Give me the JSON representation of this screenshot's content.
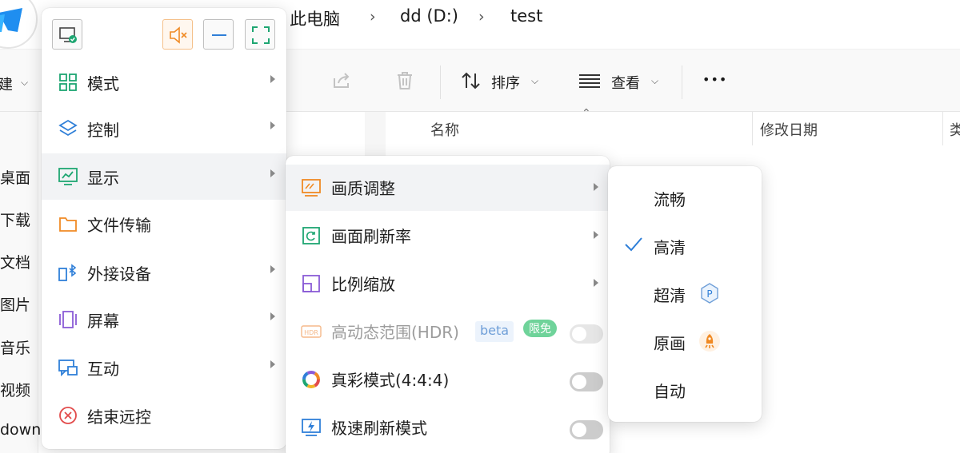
{
  "explorer": {
    "breadcrumb": [
      "此电脑",
      "dd (D:)",
      "test"
    ],
    "toolbar": {
      "sort_label": "排序",
      "view_label": "查看",
      "more_label": "•••"
    },
    "nav_items": [
      "桌面",
      "下载",
      "文档",
      "图片",
      "音乐",
      "视频",
      "down"
    ],
    "nav_top_fragment": "建",
    "columns": {
      "name": "名称",
      "modified": "修改日期",
      "type_fragment": "类"
    }
  },
  "main_menu": {
    "items": [
      {
        "label": "模式",
        "icon": "grid-icon",
        "has_submenu": true
      },
      {
        "label": "控制",
        "icon": "layers-icon",
        "has_submenu": true
      },
      {
        "label": "显示",
        "icon": "monitor-chart-icon",
        "has_submenu": true,
        "active": true
      },
      {
        "label": "文件传输",
        "icon": "folder-icon",
        "has_submenu": false
      },
      {
        "label": "外接设备",
        "icon": "bluetooth-device-icon",
        "has_submenu": true
      },
      {
        "label": "屏幕",
        "icon": "screens-icon",
        "has_submenu": true
      },
      {
        "label": "互动",
        "icon": "chat-icon",
        "has_submenu": true
      },
      {
        "label": "结束远控",
        "icon": "close-circle-icon",
        "has_submenu": false
      }
    ]
  },
  "display_menu": {
    "items": [
      {
        "label": "画质调整",
        "has_submenu": true
      },
      {
        "label": "画面刷新率",
        "has_submenu": true
      },
      {
        "label": "比例缩放",
        "has_submenu": true
      },
      {
        "label": "高动态范围(HDR)",
        "badge_beta": "beta",
        "badge_free": "限免",
        "toggle": "off",
        "disabled": true
      },
      {
        "label": "真彩模式(4:4:4)",
        "toggle": "off"
      },
      {
        "label": "极速刷新模式",
        "toggle": "off"
      }
    ]
  },
  "quality_menu": {
    "items": [
      {
        "label": "流畅",
        "selected": false
      },
      {
        "label": "高清",
        "selected": true
      },
      {
        "label": "超清",
        "selected": false,
        "badge_icon": "p-badge-icon"
      },
      {
        "label": "原画",
        "selected": false,
        "badge_icon": "rocket-badge-icon"
      },
      {
        "label": "自动",
        "selected": false
      }
    ]
  },
  "colors": {
    "accent_blue": "#2f7fd8",
    "icon_green": "#1ea672",
    "icon_orange": "#f08a24",
    "free_badge": "#6fd39a",
    "beta_text": "#6f9fd8",
    "close_red": "#e24b4b"
  }
}
